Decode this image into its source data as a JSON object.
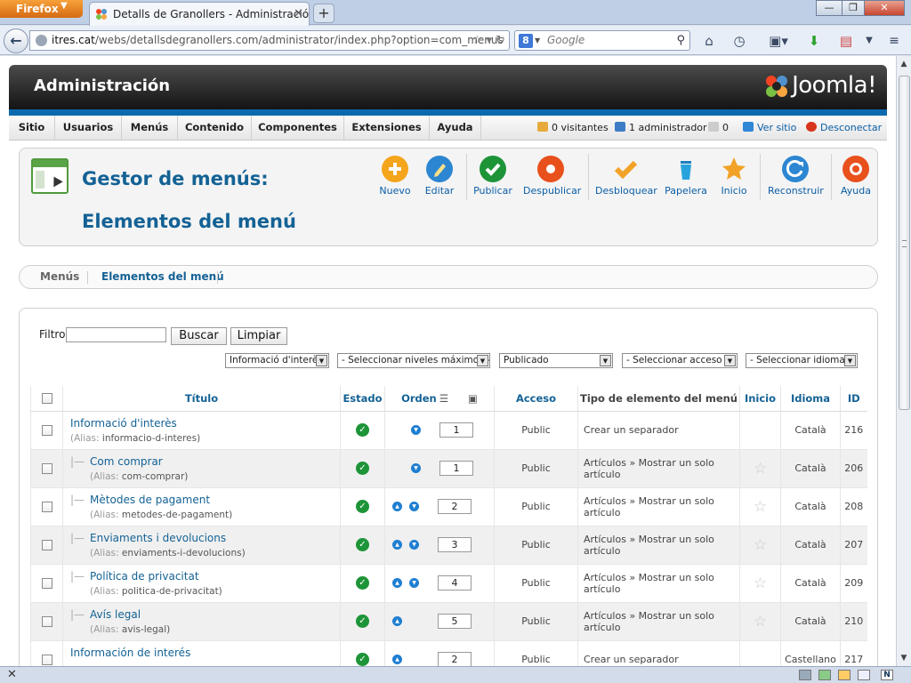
{
  "browser": {
    "app_button": "Firefox",
    "tab_title": "Detalls de Granollers - Administración - ...",
    "url_domain": "itres.cat",
    "url_rest": "/webs/detallsdegranollers.com/administrator/index.php?option=com_menus",
    "search_placeholder": "Google"
  },
  "header": {
    "title": "Administración",
    "logo_text": "Joomla!"
  },
  "menubar": {
    "items": [
      "Sitio",
      "Usuarios",
      "Menús",
      "Contenido",
      "Componentes",
      "Extensiones",
      "Ayuda"
    ],
    "visitors": "0 visitantes",
    "admins": "1 administrador",
    "messages": "0",
    "view_site": "Ver sitio",
    "logout": "Desconectar"
  },
  "toolbar": {
    "title": "Gestor de menús: Elementos del menú",
    "buttons": [
      "Nuevo",
      "Editar",
      "Publicar",
      "Despublicar",
      "Desbloquear",
      "Papelera",
      "Inicio",
      "Reconstruir",
      "Ayuda"
    ],
    "colors": {
      "new": "#f4a51c",
      "edit": "#2c86d1",
      "publish": "#1d9438",
      "unpublish": "#e8501c",
      "checkin": "#f2a227",
      "trash": "#29a3dd",
      "home": "#f2a227",
      "rebuild": "#2c86d1",
      "help": "#e8501c"
    }
  },
  "submenu": {
    "items": [
      "Menús",
      "Elementos del menú"
    ],
    "active": "Elementos del menú"
  },
  "filters": {
    "label": "Filtro:",
    "search_value": "",
    "search_button": "Buscar",
    "clear_button": "Limpiar",
    "selects": [
      "Informació d'interès",
      "- Seleccionar niveles máximos -",
      "Publicado",
      "- Seleccionar acceso -",
      "- Seleccionar idioma -"
    ]
  },
  "table": {
    "columns": {
      "title": "Título",
      "status": "Estado",
      "order": "Orden",
      "access": "Acceso",
      "type": "Tipo de elemento del menú",
      "home": "Inicio",
      "language": "Idioma",
      "id": "ID"
    },
    "alias_label": "(Alias:",
    "rows": [
      {
        "title": "Informació d'interès",
        "alias": "informacio-d-interes)",
        "order": "1",
        "access": "Public",
        "type": "Crear un separador",
        "lang": "Català",
        "id": "216"
      },
      {
        "title": "Com comprar",
        "alias": "com-comprar)",
        "order": "1",
        "access": "Public",
        "type": "Artículos » Mostrar un solo artículo",
        "lang": "Català",
        "id": "206"
      },
      {
        "title": "Mètodes de pagament",
        "alias": "metodes-de-pagament)",
        "order": "2",
        "access": "Public",
        "type": "Artículos » Mostrar un solo artículo",
        "lang": "Català",
        "id": "208"
      },
      {
        "title": "Enviaments i devolucions",
        "alias": "enviaments-i-devolucions)",
        "order": "3",
        "access": "Public",
        "type": "Artículos » Mostrar un solo artículo",
        "lang": "Català",
        "id": "207"
      },
      {
        "title": "Política de privacitat",
        "alias": "politica-de-privacitat)",
        "order": "4",
        "access": "Public",
        "type": "Artículos » Mostrar un solo artículo",
        "lang": "Català",
        "id": "209"
      },
      {
        "title": "Avís legal",
        "alias": "avis-legal)",
        "order": "5",
        "access": "Public",
        "type": "Artículos » Mostrar un solo artículo",
        "lang": "Català",
        "id": "210"
      },
      {
        "title": "Información de interés",
        "alias": "",
        "order": "2",
        "access": "Public",
        "type": "Crear un separador",
        "lang": "Castellano",
        "id": "217"
      }
    ]
  }
}
